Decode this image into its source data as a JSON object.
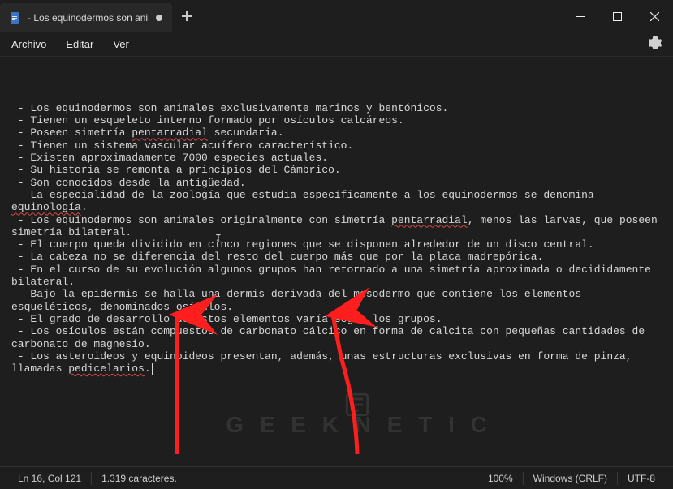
{
  "window": {
    "tab_title": "- Los equinodermos son animales e",
    "menus": {
      "file": "Archivo",
      "edit": "Editar",
      "view": "Ver"
    }
  },
  "document": {
    "lines": [
      {
        "text": " - Los equinodermos son animales exclusivamente marinos y bentónicos."
      },
      {
        "text": " - Tienen un esqueleto interno formado por osículos calcáreos."
      },
      {
        "prefix": " - Poseen simetría ",
        "squiggle": "pentarradial",
        "suffix": " secundaria."
      },
      {
        "text": " - Tienen un sistema vascular acuífero característico."
      },
      {
        "text": " - Existen aproximadamente 7000 especies actuales."
      },
      {
        "text": " - Su historia se remonta a principios del Cámbrico."
      },
      {
        "text": " - Son conocidos desde la antigüedad."
      },
      {
        "prefix": " - La especialidad de la zoología que estudia específicamente a los equinodermos se denomina ",
        "squiggle": "equinología",
        "suffix": "."
      },
      {
        "prefix": " - Los equinodermos son animales originalmente con simetría ",
        "squiggle": "pentarradial",
        "suffix": ", menos las larvas, que poseen simetría bilateral."
      },
      {
        "text": " - El cuerpo queda dividido en cinco regiones que se disponen alrededor de un disco central."
      },
      {
        "text": " - La cabeza no se diferencia del resto del cuerpo más que por la placa madrepórica."
      },
      {
        "text": " - En el curso de su evolución algunos grupos han retornado a una simetría aproximada o decididamente bilateral."
      },
      {
        "text": " - Bajo la epidermis se halla una dermis derivada del mesodermo que contiene los elementos esqueléticos, denominados osículos."
      },
      {
        "text": " - El grado de desarrollo de estos elementos varía según los grupos."
      },
      {
        "text": " - Los osículos están compuestos de carbonato cálcico en forma de calcita con pequeñas cantidades de carbonato de magnesio."
      },
      {
        "prefix": " - Los asteroideos y equinoideos presentan, además, unas estructuras exclusivas en forma de pinza, llamadas ",
        "squiggle": "pedicelarios",
        "suffix": "."
      }
    ]
  },
  "status": {
    "cursor": "Ln 16, Col 121",
    "chars": "1.319 caracteres.",
    "zoom": "100%",
    "eol": "Windows (CRLF)",
    "encoding": "UTF-8"
  },
  "watermark": "G E E K N E T I C",
  "cursor_glyph": "I"
}
